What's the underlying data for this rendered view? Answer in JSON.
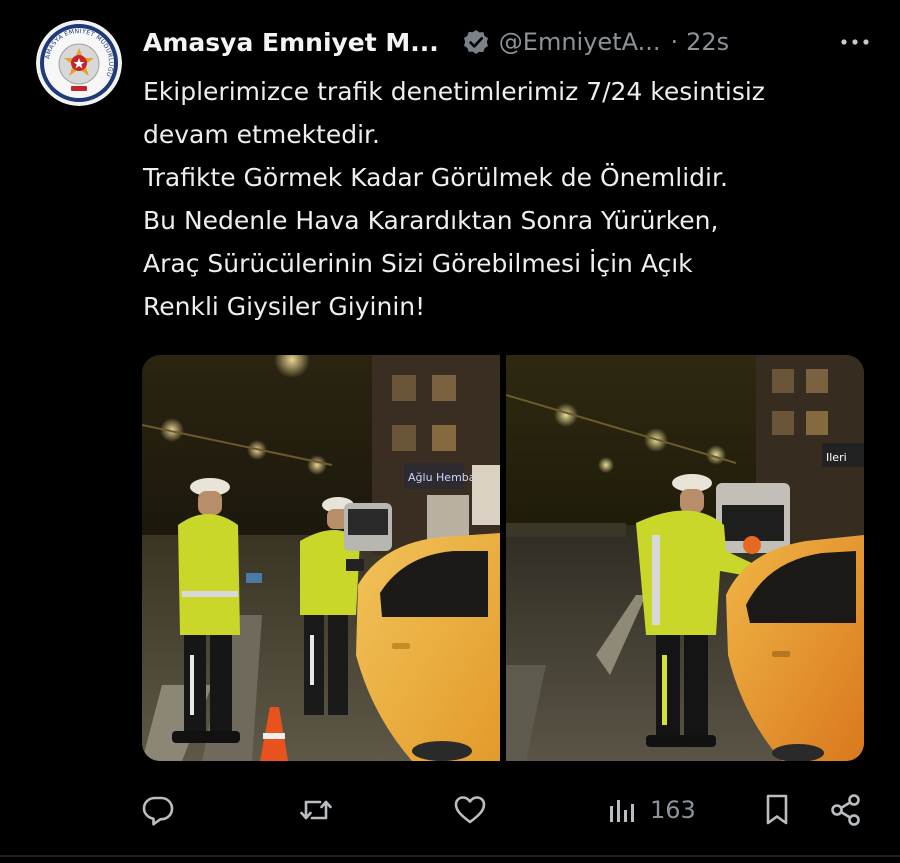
{
  "tweet": {
    "author_name": "Amasya Emniyet M...",
    "author_handle": "@EmniyetA...",
    "separator": "·",
    "time_ago": "22s",
    "avatar_icon": "police-badge-icon",
    "avatar_text": "AMASYA EMNİYET MÜDÜRLÜĞÜ",
    "verified_icon": "verified-badge-icon",
    "more_icon": "more-icon",
    "text_lines": [
      "Ekiplerimizce trafik denetimlerimiz 7/24 kesintisiz",
      "devam etmektedir.",
      "Trafikte Görmek Kadar Görülmek de Önemlidir.",
      "Bu Nedenle Hava Karardıktan Sonra Yürürken,",
      "Araç Sürücülerinin Sizi Görebilmesi İçin Açık",
      "Renkli Giysiler Giyinin!"
    ],
    "photos": [
      {
        "shop_sign": "Ağlu\nHemba"
      },
      {
        "shop_sign": "Ileri"
      }
    ]
  },
  "actions": {
    "reply_icon": "reply-icon",
    "retweet_icon": "retweet-icon",
    "like_icon": "like-icon",
    "views_icon": "views-icon",
    "views_count": "163",
    "bookmark_icon": "bookmark-icon",
    "share_icon": "share-icon"
  },
  "colors": {
    "background": "#000000",
    "text": "#e7e9ea",
    "secondary": "#8b9299",
    "verified": "#7a8188",
    "vest": "#c9d62a"
  }
}
